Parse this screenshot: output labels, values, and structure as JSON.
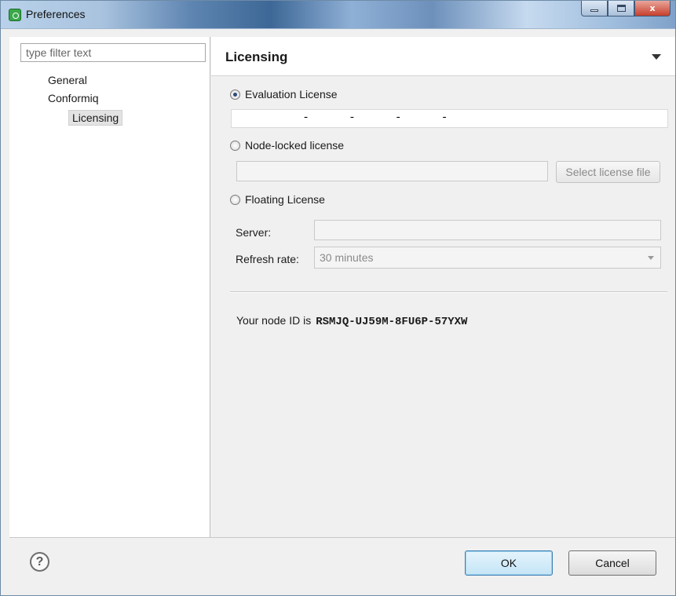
{
  "window": {
    "title": "Preferences",
    "icon": "eclipse-preferences-icon",
    "controls": {
      "minimize": "minimize-icon",
      "maximize": "maximize-icon",
      "close_label": "x"
    }
  },
  "sidebar": {
    "filter_placeholder": "type filter text",
    "items": [
      {
        "label": "General",
        "level": 0,
        "selected": false
      },
      {
        "label": "Conformiq",
        "level": 0,
        "selected": false
      },
      {
        "label": "Licensing",
        "level": 1,
        "selected": true
      }
    ]
  },
  "page": {
    "title": "Licensing",
    "menu_icon": "view-menu-arrow-icon",
    "evaluation": {
      "label": "Evaluation License",
      "checked": true,
      "key_value": "      -      -      -      -"
    },
    "node_locked": {
      "label": "Node-locked license",
      "checked": false,
      "file_value": "",
      "select_button": "Select license file"
    },
    "floating": {
      "label": "Floating License",
      "checked": false,
      "server_label": "Server:",
      "server_value": "",
      "refresh_label": "Refresh rate:",
      "refresh_value": "30 minutes"
    },
    "node_id_text": "Your node ID is",
    "node_id_value": "RSMJQ-UJ59M-8FU6P-57YXW"
  },
  "footer": {
    "help_icon": "?",
    "ok_label": "OK",
    "cancel_label": "Cancel"
  },
  "colors": {
    "accent_ok": "#3c7fb1",
    "titlebar": "#5f86b2",
    "close_button": "#c7402d"
  }
}
